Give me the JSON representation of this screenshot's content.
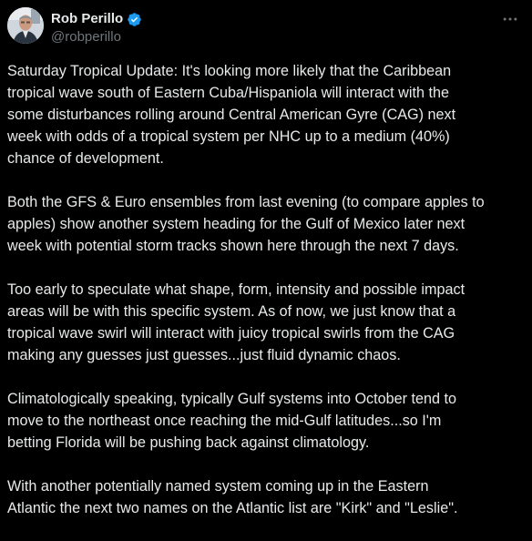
{
  "author": {
    "display_name": "Rob Perillo",
    "handle": "@robperillo",
    "verified": true,
    "avatar_icon": "profile-photo",
    "verified_icon": "verified-badge-icon",
    "verified_color": "#1d9bf0"
  },
  "menu": {
    "icon": "more-horizontal-icon"
  },
  "tweet": {
    "paragraphs": [
      "Saturday Tropical Update: It's looking more likely that the Caribbean\ntropical wave south of Eastern Cuba/Hispaniola will interact with the\nsome disturbances rolling around Central American Gyre (CAG) next\nweek with odds of a tropical system per NHC up to a medium (40%)\nchance of development.",
      "Both the GFS & Euro ensembles from last evening (to compare apples to\napples) show another system heading for the Gulf of Mexico later next\nweek with potential storm tracks shown here through the next 7 days.",
      "Too early to speculate what shape, form, intensity and possible impact\nareas will be with this specific system. As of now, we just know that a\ntropical wave swirl will interact with juicy tropical swirls from the CAG\nmaking any guesses just guesses...just fluid dynamic chaos.",
      "Climatologically speaking, typically Gulf systems into October tend to\nmove to the northeast once reaching the mid-Gulf latitudes...so I'm\nbetting Florida will be pushing back against climatology.",
      "With another potentially named system coming up in the Eastern\nAtlantic the next two names on the Atlantic list are \"Kirk\" and \"Leslie\"."
    ]
  },
  "colors": {
    "background": "#000000",
    "text": "#e7e9ea",
    "secondary_text": "#71767b",
    "accent": "#1d9bf0"
  }
}
